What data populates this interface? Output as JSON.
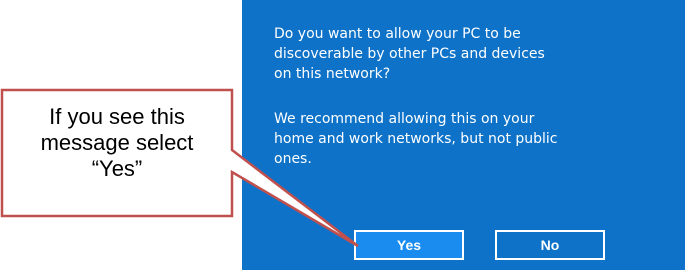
{
  "dialog": {
    "question": "Do you want to allow your PC to be discoverable by other PCs and devices on this network?",
    "recommendation": "We recommend allowing this on your home and work networks, but not public ones.",
    "yes_label": "Yes",
    "no_label": "No",
    "background_color": "#0d72c8"
  },
  "callout": {
    "text": "If you see this message select “Yes”",
    "border_color": "#c0504d"
  }
}
